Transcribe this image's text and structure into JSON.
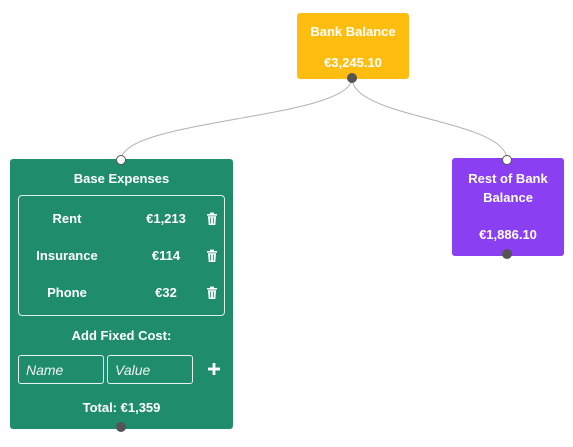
{
  "nodes": {
    "bank_balance": {
      "title": "Bank Balance",
      "amount": "€3,245.10",
      "color": "#ffbd0f"
    },
    "base_expenses": {
      "title": "Base Expenses",
      "color": "#1f8d6b",
      "fixed_costs": [
        {
          "name": "Rent",
          "value": "€1,213",
          "delete_icon": "trash-icon"
        },
        {
          "name": "Insurance",
          "value": "€114",
          "delete_icon": "trash-icon"
        },
        {
          "name": "Phone",
          "value": "€32",
          "delete_icon": "trash-icon"
        }
      ],
      "add_label": "Add Fixed Cost:",
      "name_input": {
        "value": "",
        "placeholder": "Name"
      },
      "value_input": {
        "value": "",
        "placeholder": "Value"
      },
      "add_icon": "plus-icon",
      "total": "Total: €1,359"
    },
    "rest_of_bank_balance": {
      "title": "Rest of Bank Balance",
      "amount": "€1,886.10",
      "color": "#8a3ff0"
    }
  },
  "edges": [
    {
      "from": "bank_balance",
      "to": "base_expenses"
    },
    {
      "from": "bank_balance",
      "to": "rest_of_bank_balance"
    }
  ],
  "handle_colors": {
    "input": "#ffffff",
    "output": "#555555",
    "edge": "#b1b1b7"
  }
}
